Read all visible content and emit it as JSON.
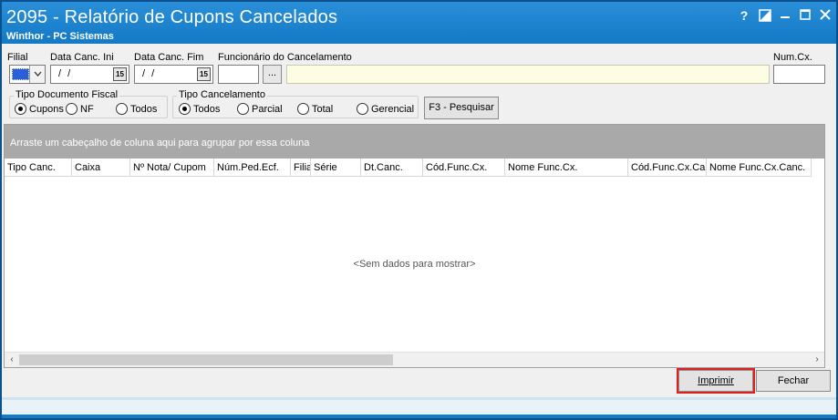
{
  "window": {
    "title": "2095 - Relatório de Cupons Cancelados",
    "subtitle": "Winthor - PC Sistemas",
    "buttons": {
      "help": "?",
      "minimize": "▬",
      "maximize": "☐",
      "close": "✕"
    }
  },
  "filters": {
    "filial_label": "Filial",
    "data_ini_label": "Data Canc. Ini",
    "data_ini_value": "/ /",
    "data_fim_label": "Data Canc. Fim",
    "data_fim_value": "/ /",
    "calendar_glyph": "15",
    "funcionario_label": "Funcionário do Cancelamento",
    "funcionario_button": "...",
    "numcx_label": "Num.Cx."
  },
  "tipo_documento": {
    "title": "Tipo Documento Fiscal",
    "options": [
      "Cupons",
      "NF",
      "Todos"
    ],
    "selected": "Cupons"
  },
  "tipo_cancelamento": {
    "title": "Tipo Cancelamento",
    "options": [
      "Todos",
      "Parcial",
      "Total",
      "Gerencial"
    ],
    "selected": "Todos"
  },
  "search_button": "F3 - Pesquisar",
  "grid": {
    "group_hint": "Arraste um cabeçalho de coluna aqui para agrupar por essa coluna",
    "columns": [
      "Tipo Canc.",
      "Caixa",
      "Nº Nota/ Cupom",
      "Núm.Ped.Ecf.",
      "Filial",
      "Série",
      "Dt.Canc.",
      "Cód.Func.Cx.",
      "Nome Func.Cx.",
      "Cód.Func.Cx.Canc.",
      "Nome Func.Cx.Canc."
    ],
    "empty_message": "<Sem dados para mostrar>",
    "scroll_left": "‹",
    "scroll_right": "›"
  },
  "actions": {
    "print": "Imprimir",
    "close": "Fechar"
  },
  "colors": {
    "title_bar": "#1479c6",
    "highlight": "#e02020",
    "group_bar": "#a9a9a9"
  }
}
